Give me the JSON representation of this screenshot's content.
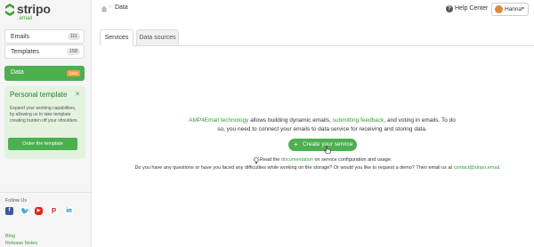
{
  "brand": {
    "name": "stripo",
    "subtitle": ".email",
    "accent": "#4caf50"
  },
  "sidebar": {
    "emails": {
      "label": "Emails",
      "count": "111"
    },
    "templates": {
      "label": "Templates",
      "count": "158"
    },
    "data": {
      "label": "Data",
      "badge": "beta"
    },
    "promo": {
      "title": "Personal template",
      "text": "Expand your working capabilities, by allowing us to take template creating burden off your shoulders",
      "button": "Order the template"
    },
    "follow_label": "Follow Us",
    "socials": [
      "facebook-icon",
      "twitter-icon",
      "youtube-icon",
      "pinterest-icon",
      "linkedin-icon"
    ],
    "links": [
      "Blog",
      "Release Notes"
    ]
  },
  "header": {
    "breadcrumb": "Data",
    "help": "Help Center",
    "user": "Hanna"
  },
  "tabs": [
    "Services",
    "Data sources"
  ],
  "main": {
    "desc": {
      "link1": "AMP4Email technology",
      "text1": " allows building dynamic emails, ",
      "link2": "submitting feedback",
      "text2": ", and voting in emails. To do so, you need to connect your emails to data service for receiving and storing data."
    },
    "create_button": "Create your service",
    "doc": {
      "pre": "Read the ",
      "link": "documentation",
      "post": " on service configuration and usage."
    },
    "question": {
      "text": "Do you have any questions or have you faced any difficulties while working on the storage? Or would you like to request a demo? Then email us at ",
      "email": "contact@stripo.email",
      "end": "."
    }
  }
}
